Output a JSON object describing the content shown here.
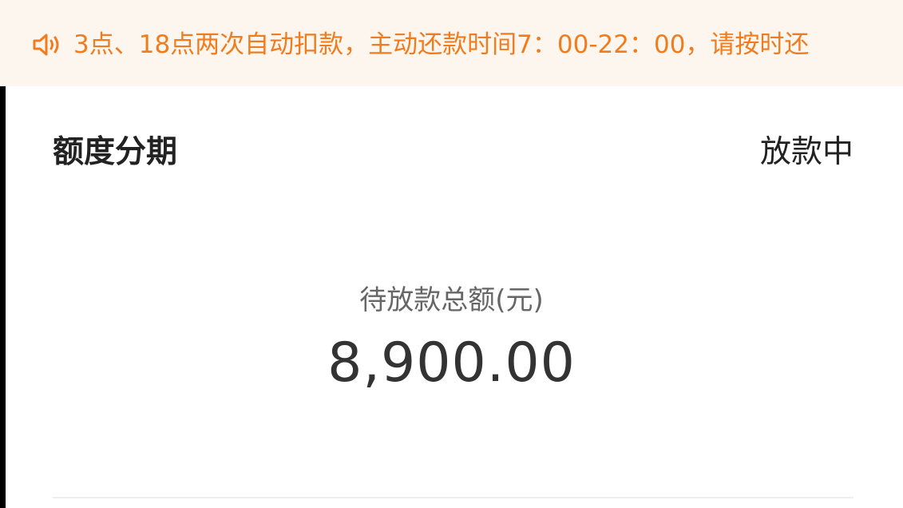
{
  "notice": {
    "icon": "speaker-icon",
    "text": "3点、18点两次自动扣款，主动还款时间7：00-22：00，请按时还",
    "color": "#f07c1e",
    "background": "#fdf6ee"
  },
  "card": {
    "title": "额度分期",
    "status": "放款中"
  },
  "amount": {
    "label": "待放款总额(元)",
    "value": "8,900.00"
  }
}
